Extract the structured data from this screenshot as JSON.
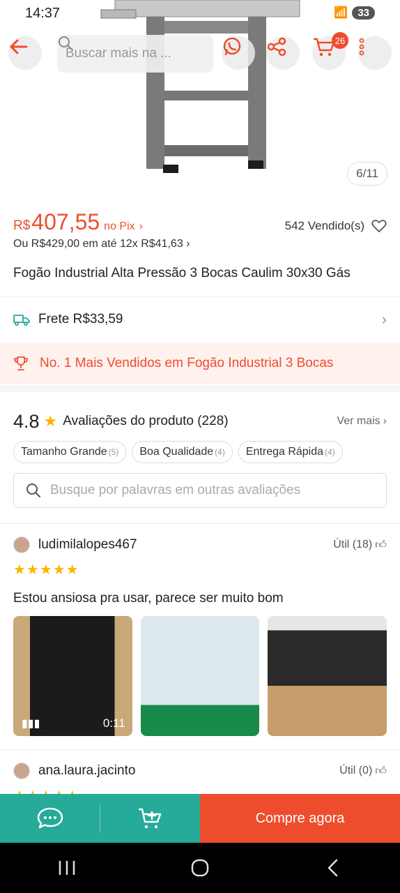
{
  "status": {
    "time": "14:37",
    "battery": "33"
  },
  "search": {
    "placeholder": "Buscar mais na ..."
  },
  "cart": {
    "count": "26"
  },
  "gallery": {
    "counter": "6/11"
  },
  "product": {
    "currency": "R$",
    "price": "407,55",
    "pix_label": "no Pix",
    "installments": "Ou R$429,00 em até 12x R$41,63",
    "sold": "542 Vendido(s)",
    "title": "Fogão Industrial Alta Pressão 3 Bocas Caulim 30x30 Gás"
  },
  "shipping": {
    "label": "Frete R$33,59"
  },
  "ranking": {
    "label": "No. 1 Mais Vendidos em Fogão Industrial 3 Bocas"
  },
  "reviews": {
    "rating": "4.8",
    "title": "Avaliações do produto (228)",
    "see_more": "Ver mais",
    "tags": [
      {
        "label": "Tamanho Grande",
        "count": "(5)"
      },
      {
        "label": "Boa Qualidade",
        "count": "(4)"
      },
      {
        "label": "Entrega Rápida",
        "count": "(4)"
      }
    ],
    "search_placeholder": "Busque por palavras em outras avaliações",
    "items": [
      {
        "user": "ludimilalopes467",
        "helpful": "Útil (18)",
        "stars": "★★★★★",
        "text": "Estou ansiosa pra usar, parece ser muito bom",
        "video_duration": "0:11"
      },
      {
        "user": "ana.laura.jacinto",
        "helpful": "Útil (0)",
        "stars": "★★★★★"
      }
    ]
  },
  "actions": {
    "buy_label": "Compre agora"
  },
  "colors": {
    "brand": "#ee4d2d",
    "teal": "#26aa99",
    "star": "#ffb400"
  }
}
